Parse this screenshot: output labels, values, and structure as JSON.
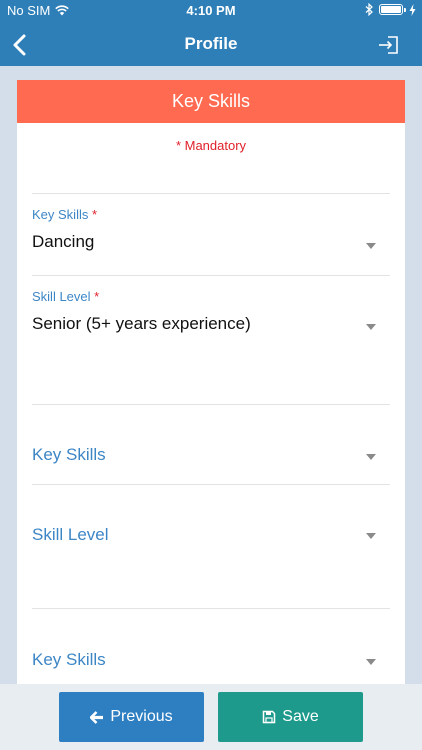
{
  "status_bar": {
    "carrier": "No SIM",
    "time": "4:10 PM"
  },
  "nav": {
    "title": "Profile"
  },
  "card": {
    "header": "Key Skills",
    "mandatory_note": "* Mandatory",
    "groups": [
      {
        "skill_label": "Key Skills",
        "skill_required": "*",
        "skill_value": "Dancing",
        "level_label": "Skill Level",
        "level_required": "*",
        "level_value": "Senior (5+ years experience)"
      },
      {
        "skill_placeholder": "Key Skills",
        "level_placeholder": "Skill Level"
      },
      {
        "skill_placeholder": "Key Skills"
      }
    ]
  },
  "footer": {
    "previous_label": "Previous",
    "save_label": "Save"
  },
  "colors": {
    "nav": "#2e7fb8",
    "header": "#ff6a50",
    "accent_text": "#3d86c6",
    "required": "#e0212b",
    "previous": "#2e7fc2",
    "save": "#1d9a8c"
  },
  "icons": [
    "wifi-icon",
    "bluetooth-icon",
    "battery-icon",
    "charging-icon",
    "back-chevron-icon",
    "logout-icon",
    "dropdown-caret-icon",
    "arrow-left-icon",
    "floppy-disk-icon"
  ]
}
